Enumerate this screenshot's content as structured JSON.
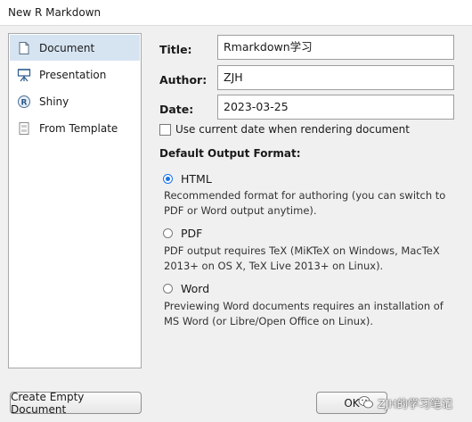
{
  "window": {
    "title": "New R Markdown"
  },
  "sidebar": {
    "items": [
      {
        "label": "Document",
        "icon": "document-icon",
        "selected": true
      },
      {
        "label": "Presentation",
        "icon": "presentation-easel-icon",
        "selected": false
      },
      {
        "label": "Shiny",
        "icon": "shiny-r-icon",
        "selected": false
      },
      {
        "label": "From Template",
        "icon": "template-icon",
        "selected": false
      }
    ]
  },
  "form": {
    "title_label": "Title:",
    "title_value": "Rmarkdown学习",
    "author_label": "Author:",
    "author_value": "ZJH",
    "date_label": "Date:",
    "date_value": "2023-03-25",
    "use_current_date_label": "Use current date when rendering document",
    "use_current_date_checked": false
  },
  "output_format": {
    "section_title": "Default Output Format:",
    "options": [
      {
        "label": "HTML",
        "checked": true,
        "description": "Recommended format for authoring (you can switch to PDF or Word output anytime)."
      },
      {
        "label": "PDF",
        "checked": false,
        "description": "PDF output requires TeX (MiKTeX on Windows, MacTeX 2013+ on OS X, TeX Live 2013+ on Linux)."
      },
      {
        "label": "Word",
        "checked": false,
        "description": "Previewing Word documents requires an installation of MS Word (or Libre/Open Office on Linux)."
      }
    ]
  },
  "buttons": {
    "create_empty": "Create Empty Document",
    "ok": "OK"
  },
  "watermark": {
    "text": "ZJH的学习笔记"
  },
  "colors": {
    "accent": "#1a73e8",
    "selected_bg": "#d6e4f2"
  }
}
